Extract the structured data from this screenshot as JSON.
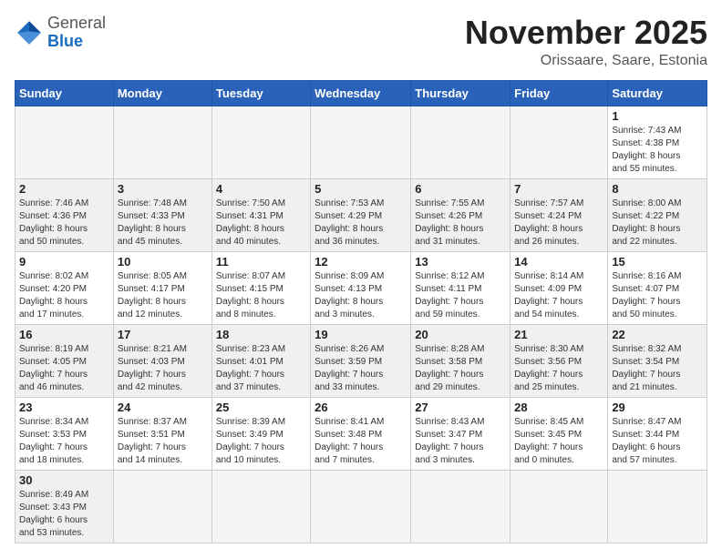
{
  "header": {
    "logo_general": "General",
    "logo_blue": "Blue",
    "month_title": "November 2025",
    "location": "Orissaare, Saare, Estonia"
  },
  "weekdays": [
    "Sunday",
    "Monday",
    "Tuesday",
    "Wednesday",
    "Thursday",
    "Friday",
    "Saturday"
  ],
  "weeks": [
    {
      "style": "light",
      "days": [
        {
          "num": "",
          "info": ""
        },
        {
          "num": "",
          "info": ""
        },
        {
          "num": "",
          "info": ""
        },
        {
          "num": "",
          "info": ""
        },
        {
          "num": "",
          "info": ""
        },
        {
          "num": "",
          "info": ""
        },
        {
          "num": "1",
          "info": "Sunrise: 7:43 AM\nSunset: 4:38 PM\nDaylight: 8 hours\nand 55 minutes."
        }
      ]
    },
    {
      "style": "gray",
      "days": [
        {
          "num": "2",
          "info": "Sunrise: 7:46 AM\nSunset: 4:36 PM\nDaylight: 8 hours\nand 50 minutes."
        },
        {
          "num": "3",
          "info": "Sunrise: 7:48 AM\nSunset: 4:33 PM\nDaylight: 8 hours\nand 45 minutes."
        },
        {
          "num": "4",
          "info": "Sunrise: 7:50 AM\nSunset: 4:31 PM\nDaylight: 8 hours\nand 40 minutes."
        },
        {
          "num": "5",
          "info": "Sunrise: 7:53 AM\nSunset: 4:29 PM\nDaylight: 8 hours\nand 36 minutes."
        },
        {
          "num": "6",
          "info": "Sunrise: 7:55 AM\nSunset: 4:26 PM\nDaylight: 8 hours\nand 31 minutes."
        },
        {
          "num": "7",
          "info": "Sunrise: 7:57 AM\nSunset: 4:24 PM\nDaylight: 8 hours\nand 26 minutes."
        },
        {
          "num": "8",
          "info": "Sunrise: 8:00 AM\nSunset: 4:22 PM\nDaylight: 8 hours\nand 22 minutes."
        }
      ]
    },
    {
      "style": "light",
      "days": [
        {
          "num": "9",
          "info": "Sunrise: 8:02 AM\nSunset: 4:20 PM\nDaylight: 8 hours\nand 17 minutes."
        },
        {
          "num": "10",
          "info": "Sunrise: 8:05 AM\nSunset: 4:17 PM\nDaylight: 8 hours\nand 12 minutes."
        },
        {
          "num": "11",
          "info": "Sunrise: 8:07 AM\nSunset: 4:15 PM\nDaylight: 8 hours\nand 8 minutes."
        },
        {
          "num": "12",
          "info": "Sunrise: 8:09 AM\nSunset: 4:13 PM\nDaylight: 8 hours\nand 3 minutes."
        },
        {
          "num": "13",
          "info": "Sunrise: 8:12 AM\nSunset: 4:11 PM\nDaylight: 7 hours\nand 59 minutes."
        },
        {
          "num": "14",
          "info": "Sunrise: 8:14 AM\nSunset: 4:09 PM\nDaylight: 7 hours\nand 54 minutes."
        },
        {
          "num": "15",
          "info": "Sunrise: 8:16 AM\nSunset: 4:07 PM\nDaylight: 7 hours\nand 50 minutes."
        }
      ]
    },
    {
      "style": "gray",
      "days": [
        {
          "num": "16",
          "info": "Sunrise: 8:19 AM\nSunset: 4:05 PM\nDaylight: 7 hours\nand 46 minutes."
        },
        {
          "num": "17",
          "info": "Sunrise: 8:21 AM\nSunset: 4:03 PM\nDaylight: 7 hours\nand 42 minutes."
        },
        {
          "num": "18",
          "info": "Sunrise: 8:23 AM\nSunset: 4:01 PM\nDaylight: 7 hours\nand 37 minutes."
        },
        {
          "num": "19",
          "info": "Sunrise: 8:26 AM\nSunset: 3:59 PM\nDaylight: 7 hours\nand 33 minutes."
        },
        {
          "num": "20",
          "info": "Sunrise: 8:28 AM\nSunset: 3:58 PM\nDaylight: 7 hours\nand 29 minutes."
        },
        {
          "num": "21",
          "info": "Sunrise: 8:30 AM\nSunset: 3:56 PM\nDaylight: 7 hours\nand 25 minutes."
        },
        {
          "num": "22",
          "info": "Sunrise: 8:32 AM\nSunset: 3:54 PM\nDaylight: 7 hours\nand 21 minutes."
        }
      ]
    },
    {
      "style": "light",
      "days": [
        {
          "num": "23",
          "info": "Sunrise: 8:34 AM\nSunset: 3:53 PM\nDaylight: 7 hours\nand 18 minutes."
        },
        {
          "num": "24",
          "info": "Sunrise: 8:37 AM\nSunset: 3:51 PM\nDaylight: 7 hours\nand 14 minutes."
        },
        {
          "num": "25",
          "info": "Sunrise: 8:39 AM\nSunset: 3:49 PM\nDaylight: 7 hours\nand 10 minutes."
        },
        {
          "num": "26",
          "info": "Sunrise: 8:41 AM\nSunset: 3:48 PM\nDaylight: 7 hours\nand 7 minutes."
        },
        {
          "num": "27",
          "info": "Sunrise: 8:43 AM\nSunset: 3:47 PM\nDaylight: 7 hours\nand 3 minutes."
        },
        {
          "num": "28",
          "info": "Sunrise: 8:45 AM\nSunset: 3:45 PM\nDaylight: 7 hours\nand 0 minutes."
        },
        {
          "num": "29",
          "info": "Sunrise: 8:47 AM\nSunset: 3:44 PM\nDaylight: 6 hours\nand 57 minutes."
        }
      ]
    },
    {
      "style": "gray",
      "days": [
        {
          "num": "30",
          "info": "Sunrise: 8:49 AM\nSunset: 3:43 PM\nDaylight: 6 hours\nand 53 minutes."
        },
        {
          "num": "",
          "info": ""
        },
        {
          "num": "",
          "info": ""
        },
        {
          "num": "",
          "info": ""
        },
        {
          "num": "",
          "info": ""
        },
        {
          "num": "",
          "info": ""
        },
        {
          "num": "",
          "info": ""
        }
      ]
    }
  ]
}
